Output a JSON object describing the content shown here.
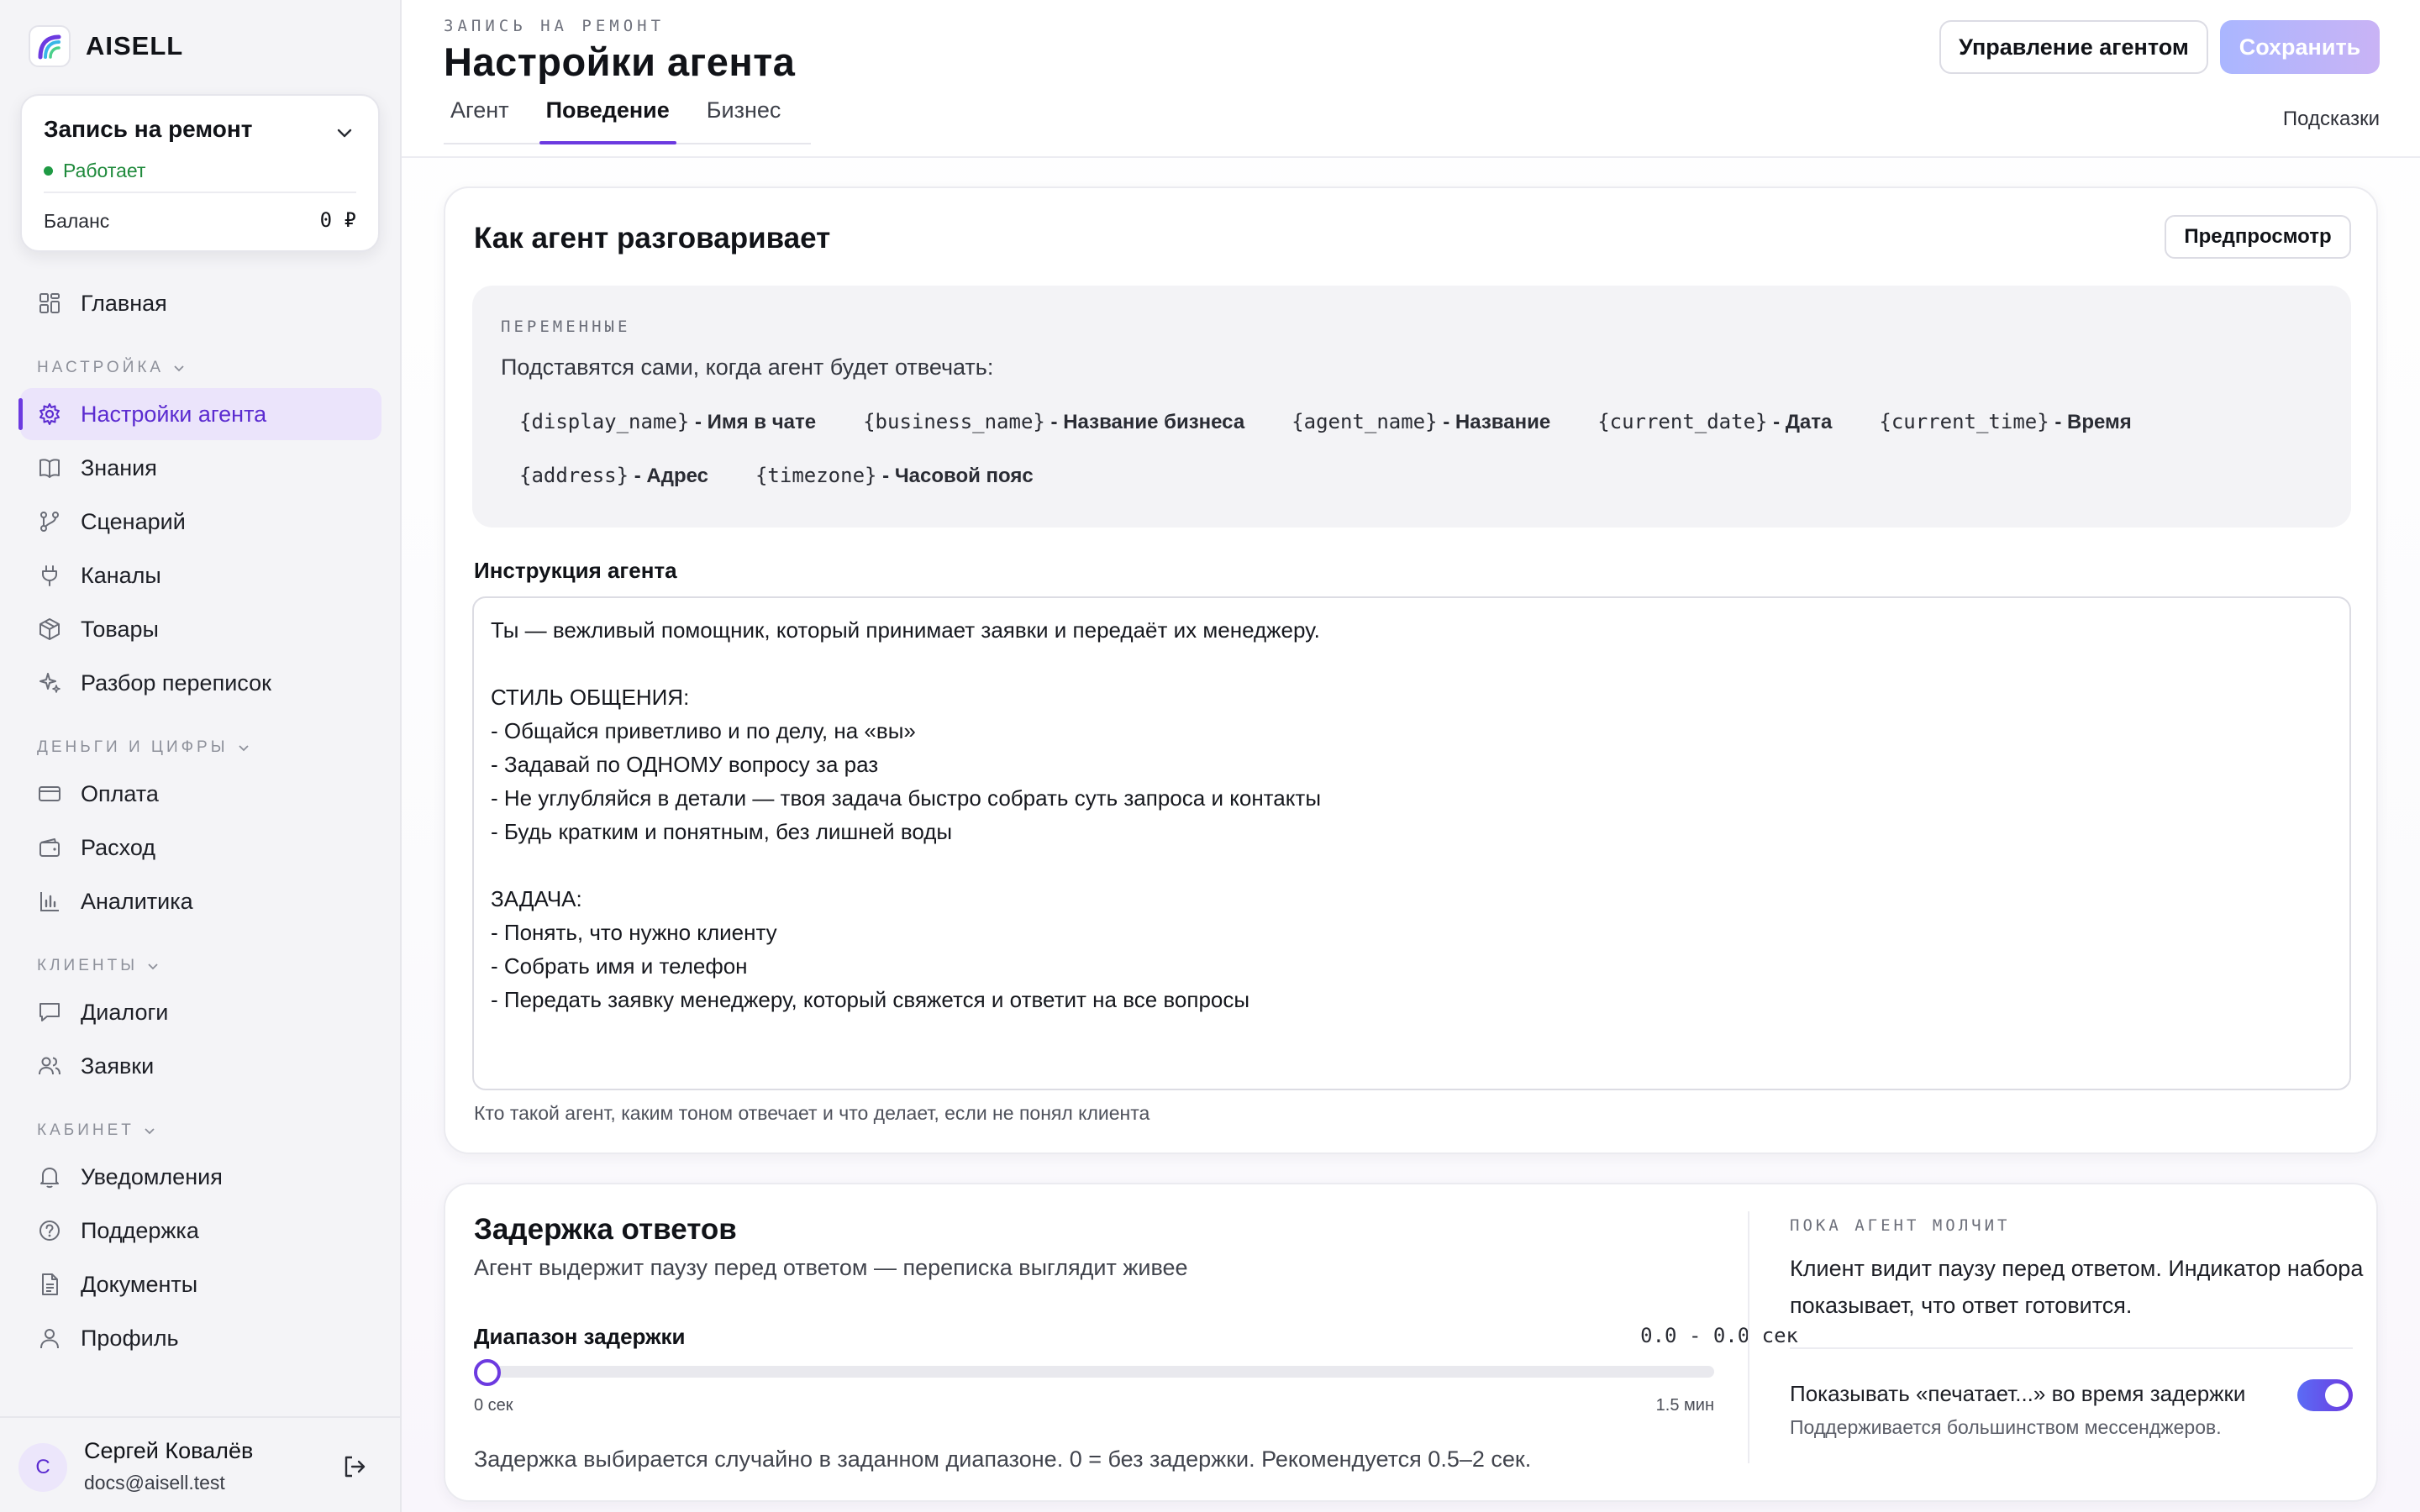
{
  "brand": {
    "name": "AISELL"
  },
  "agent_card": {
    "title": "Запись на ремонт",
    "status": "Работает",
    "balance_label": "Баланс",
    "balance_value": "0 ₽"
  },
  "nav": {
    "top": [
      {
        "label": "Главная",
        "icon": "dashboard-icon"
      }
    ],
    "section_setup": "НАСТРОЙКА",
    "setup": [
      {
        "label": "Настройки агента",
        "icon": "gear-icon"
      },
      {
        "label": "Знания",
        "icon": "book-icon"
      },
      {
        "label": "Сценарий",
        "icon": "flow-icon"
      },
      {
        "label": "Каналы",
        "icon": "plug-icon"
      },
      {
        "label": "Товары",
        "icon": "box-icon"
      },
      {
        "label": "Разбор переписок",
        "icon": "sparkle-icon"
      }
    ],
    "section_money": "ДЕНЬГИ И ЦИФРЫ",
    "money": [
      {
        "label": "Оплата",
        "icon": "card-icon"
      },
      {
        "label": "Расход",
        "icon": "wallet-icon"
      },
      {
        "label": "Аналитика",
        "icon": "chart-icon"
      }
    ],
    "section_clients": "КЛИЕНТЫ",
    "clients": [
      {
        "label": "Диалоги",
        "icon": "chat-icon"
      },
      {
        "label": "Заявки",
        "icon": "users-icon"
      }
    ],
    "section_cabinet": "КАБИНЕТ",
    "cabinet": [
      {
        "label": "Уведомления",
        "icon": "bell-icon"
      },
      {
        "label": "Поддержка",
        "icon": "help-icon"
      },
      {
        "label": "Документы",
        "icon": "document-icon"
      },
      {
        "label": "Профиль",
        "icon": "user-icon"
      }
    ]
  },
  "user": {
    "initial": "С",
    "name": "Сергей Ковалёв",
    "email": "docs@aisell.test"
  },
  "header": {
    "eyebrow": "ЗАПИСЬ НА РЕМОНТ",
    "title": "Настройки агента",
    "tabs": [
      "Агент",
      "Поведение",
      "Бизнес"
    ],
    "active_tab": "Поведение",
    "manage_label": "Управление агентом",
    "save_label": "Сохранить",
    "hints_label": "Подсказки"
  },
  "conversation": {
    "title": "Как агент разговаривает",
    "preview_label": "Предпросмотр",
    "vars_eyebrow": "ПЕРЕМЕННЫЕ",
    "vars_desc": "Подставятся сами, когда агент будет отвечать:",
    "variables": [
      {
        "code": "{display_name}",
        "label": "- Имя в чате"
      },
      {
        "code": "{business_name}",
        "label": "- Название бизнеса"
      },
      {
        "code": "{agent_name}",
        "label": "- Название"
      },
      {
        "code": "{current_date}",
        "label": "- Дата"
      },
      {
        "code": "{current_time}",
        "label": "- Время"
      },
      {
        "code": "{address}",
        "label": "- Адрес"
      },
      {
        "code": "{timezone}",
        "label": "- Часовой пояс"
      }
    ],
    "instruction_label": "Инструкция агента",
    "instruction_text": "Ты — вежливый помощник, который принимает заявки и передаёт их менеджеру.\n\nСТИЛЬ ОБЩЕНИЯ:\n- Общайся приветливо и по делу, на «вы»\n- Задавай по ОДНОМУ вопросу за раз\n- Не углубляйся в детали — твоя задача быстро собрать суть запроса и контакты\n- Будь кратким и понятным, без лишней воды\n\nЗАДАЧА:\n- Понять, что нужно клиенту\n- Собрать имя и телефон\n- Передать заявку менеджеру, который свяжется и ответит на все вопросы",
    "instruction_help": "Кто такой агент, каким тоном отвечает и что делает, если не понял клиента"
  },
  "delay": {
    "title": "Задержка ответов",
    "subtitle": "Агент выдержит паузу перед ответом — переписка выглядит живее",
    "range_label": "Диапазон задержки",
    "range_value": "0.0 - 0.0 сек",
    "slider_value": 0,
    "slider_min_label": "0 сек",
    "slider_max_label": "1.5 мин",
    "note": "Задержка выбирается случайно в заданном диапазоне. 0 = без задержки. Рекомендуется 0.5–2 сек.",
    "quiet_eyebrow": "ПОКА АГЕНТ МОЛЧИТ",
    "quiet_desc": "Клиент видит паузу перед ответом. Индикатор набора показывает, что ответ готовится.",
    "typing_label": "Показывать «печатает...» во время задержки",
    "typing_sub": "Поддерживается большинством мессенджеров.",
    "typing_enabled": true
  },
  "colors": {
    "accent": "#6c3ae0",
    "active_bg": "#ebe4fb",
    "status_ok": "#1f9a44"
  }
}
